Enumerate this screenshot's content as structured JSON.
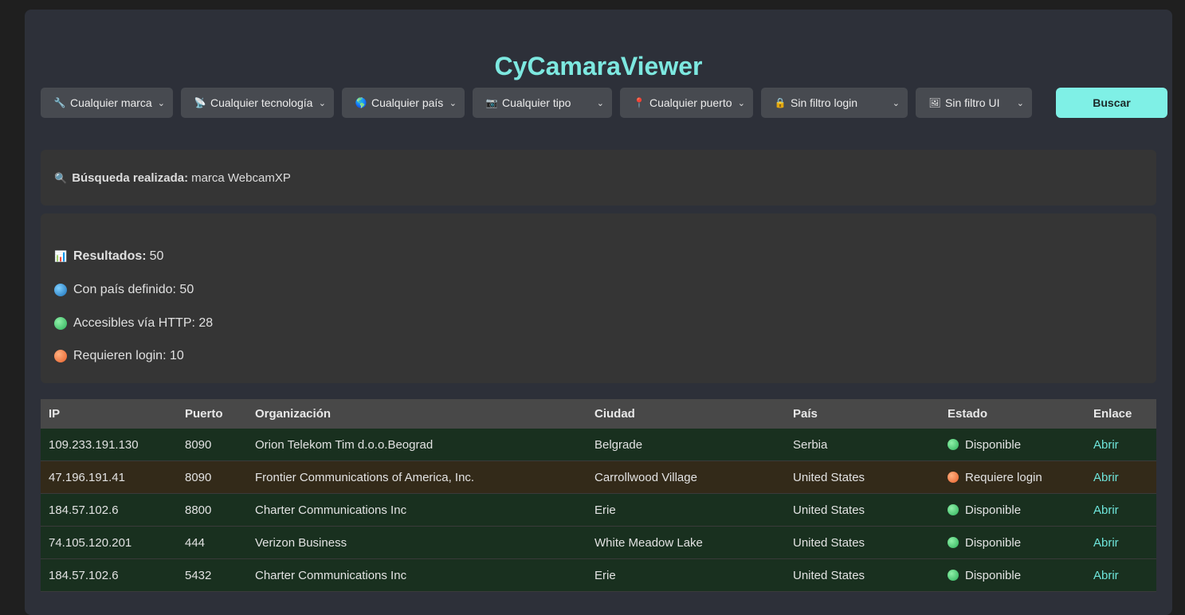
{
  "app": {
    "title": "CyCamaraViewer"
  },
  "filters": [
    {
      "icon": "wrench-icon",
      "glyph": "🔧",
      "label": "Cualquier marca"
    },
    {
      "icon": "satellite-icon",
      "glyph": "📡",
      "label": "Cualquier tecnología"
    },
    {
      "icon": "globe-icon",
      "glyph": "🌎",
      "label": "Cualquier país"
    },
    {
      "icon": "camera-icon",
      "glyph": "📷",
      "label": "Cualquier tipo"
    },
    {
      "icon": "pin-icon",
      "glyph": "📍",
      "label": "Cualquier puerto"
    },
    {
      "icon": "lock-icon",
      "glyph": "🔒",
      "label": "Sin filtro login"
    },
    {
      "icon": "frame-icon",
      "glyph": "🖼",
      "label": "Sin filtro UI"
    }
  ],
  "search_button": "Buscar",
  "query": {
    "icon": "magnifier-icon",
    "label": "Búsqueda realizada:",
    "value": "marca WebcamXP"
  },
  "stats": {
    "results_label": "Resultados:",
    "results_value": "50",
    "country_text": "Con país definido: 50",
    "http_text": "Accesibles vía HTTP: 28",
    "login_text": "Requieren login: 10"
  },
  "table": {
    "headers": [
      "IP",
      "Puerto",
      "Organización",
      "Ciudad",
      "País",
      "Estado",
      "Enlace"
    ],
    "rows": [
      {
        "ip": "109.233.191.130",
        "port": "8090",
        "org": "Orion Telekom Tim d.o.o.Beograd",
        "city": "Belgrade",
        "country": "Serbia",
        "status": "Disponible",
        "link": "Abrir"
      },
      {
        "ip": "47.196.191.41",
        "port": "8090",
        "org": "Frontier Communications of America, Inc.",
        "city": "Carrollwood Village",
        "country": "United States",
        "status": "Requiere login",
        "link": "Abrir"
      },
      {
        "ip": "184.57.102.6",
        "port": "8800",
        "org": "Charter Communications Inc",
        "city": "Erie",
        "country": "United States",
        "status": "Disponible",
        "link": "Abrir"
      },
      {
        "ip": "74.105.120.201",
        "port": "444",
        "org": "Verizon Business",
        "city": "White Meadow Lake",
        "country": "United States",
        "status": "Disponible",
        "link": "Abrir"
      },
      {
        "ip": "184.57.102.6",
        "port": "5432",
        "org": "Charter Communications Inc",
        "city": "Erie",
        "country": "United States",
        "status": "Disponible",
        "link": "Abrir"
      }
    ]
  },
  "colors": {
    "accent": "#7ff0e6",
    "available_row": "#19301f",
    "login_row": "#332a19",
    "available_dot": "#2db15a",
    "login_dot": "#e8602a"
  }
}
